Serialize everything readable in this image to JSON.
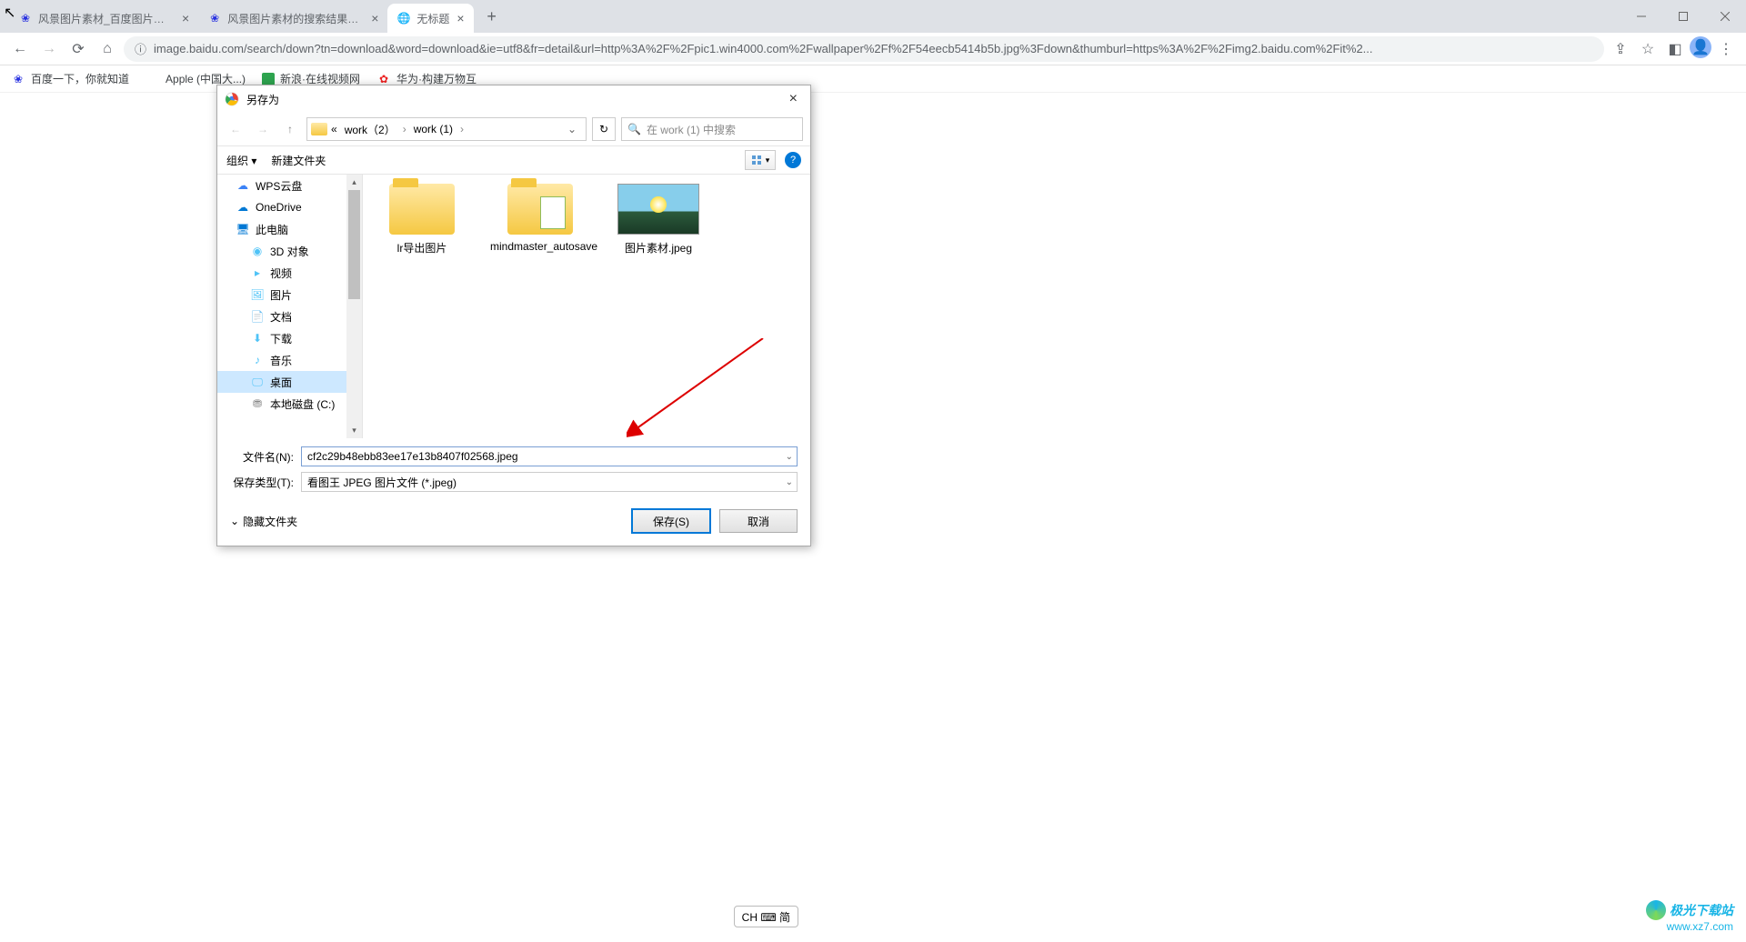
{
  "tabs": [
    {
      "title": "风景图片素材_百度图片搜索",
      "favicon": "baidu"
    },
    {
      "title": "风景图片素材的搜索结果_百度图",
      "favicon": "baidu"
    },
    {
      "title": "无标题",
      "favicon": "globe",
      "active": true
    }
  ],
  "windowControls": {
    "minimize": "–",
    "maximize": "◻",
    "close": "✕"
  },
  "address": {
    "security": "ⓘ",
    "url": "image.baidu.com/search/down?tn=download&word=download&ie=utf8&fr=detail&url=http%3A%2F%2Fpic1.win4000.com%2Fwallpaper%2Ff%2F54eecb5414b5b.jpg%3Fdown&thumburl=https%3A%2F%2Fimg2.baidu.com%2Fit%2..."
  },
  "bookmarks": [
    {
      "icon": "baidu",
      "label": "百度一下，你就知道"
    },
    {
      "icon": "apple",
      "label": "Apple (中国大...)"
    },
    {
      "icon": "green",
      "label": "新浪·在线视频网"
    },
    {
      "icon": "huawei",
      "label": "华为·构建万物互"
    }
  ],
  "dialog": {
    "title": "另存为",
    "breadcrumb": {
      "pre": "«",
      "parts": [
        "work（2）",
        "work (1)"
      ],
      "sep": "›"
    },
    "searchPlaceholder": "在 work (1) 中搜索",
    "toolbar": {
      "organize": "组织 ▾",
      "newFolder": "新建文件夹"
    },
    "tree": [
      {
        "label": "WPS云盘",
        "icon": "wps",
        "indent": false
      },
      {
        "label": "OneDrive",
        "icon": "onedrive",
        "indent": false
      },
      {
        "label": "此电脑",
        "icon": "pc",
        "indent": false
      },
      {
        "label": "3D 对象",
        "icon": "3d",
        "indent": true
      },
      {
        "label": "视频",
        "icon": "video",
        "indent": true
      },
      {
        "label": "图片",
        "icon": "pictures",
        "indent": true
      },
      {
        "label": "文档",
        "icon": "docs",
        "indent": true
      },
      {
        "label": "下载",
        "icon": "downloads",
        "indent": true
      },
      {
        "label": "音乐",
        "icon": "music",
        "indent": true
      },
      {
        "label": "桌面",
        "icon": "desktop",
        "indent": true,
        "selected": true
      },
      {
        "label": "本地磁盘 (C:)",
        "icon": "disk",
        "indent": true
      }
    ],
    "files": [
      {
        "type": "folder",
        "label": "lr导出图片"
      },
      {
        "type": "folder-doc",
        "label": "mindmaster_autosave"
      },
      {
        "type": "image",
        "label": "图片素材.jpeg"
      }
    ],
    "filenameLabel": "文件名(N):",
    "filename": "cf2c29b48ebb83ee17e13b8407f02568.jpeg",
    "saveTypeLabel": "保存类型(T):",
    "saveType": "看图王 JPEG 图片文件 (*.jpeg)",
    "hideFolders": "隐藏文件夹",
    "saveBtn": "保存(S)",
    "cancelBtn": "取消"
  },
  "ime": {
    "text": "CH ⌨ 简"
  },
  "watermark": {
    "line1": "极光下载站",
    "line2": "www.xz7.com"
  }
}
